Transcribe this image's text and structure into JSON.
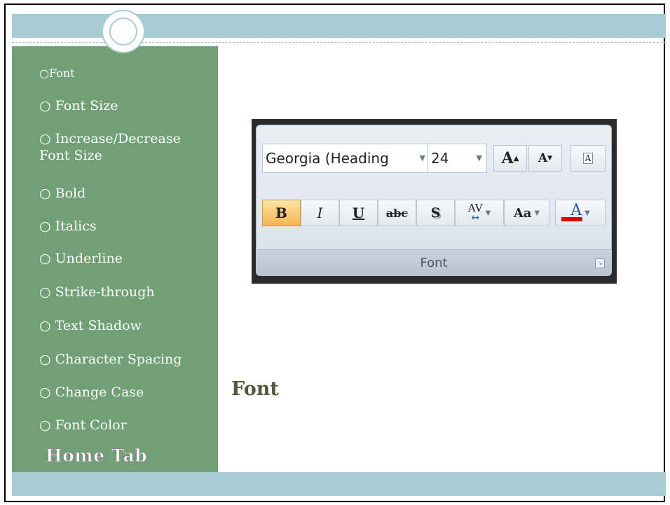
{
  "sidebar": {
    "items": [
      "○Font",
      "○ Font Size",
      "○ Increase/Decrease Font Size",
      "○ Bold",
      "○ Italics",
      "○ Underline",
      "○ Strike-through",
      "○ Text Shadow",
      "○ Character Spacing",
      "○ Change Case",
      "○ Font Color"
    ],
    "footer": "Home Tab"
  },
  "caption": "Font",
  "ribbon": {
    "font_name": "Georgia (Heading",
    "font_size": "24",
    "grow_label": "A",
    "shrink_label": "A",
    "clear_label": "A",
    "bold_label": "B",
    "italic_label": "I",
    "underline_label": "U",
    "strike_label": "abc",
    "shadow_label": "S",
    "spacing_label": "AV",
    "case_label": "Aa",
    "color_label": "A",
    "group_label": "Font",
    "font_color_hex": "#e00000"
  }
}
